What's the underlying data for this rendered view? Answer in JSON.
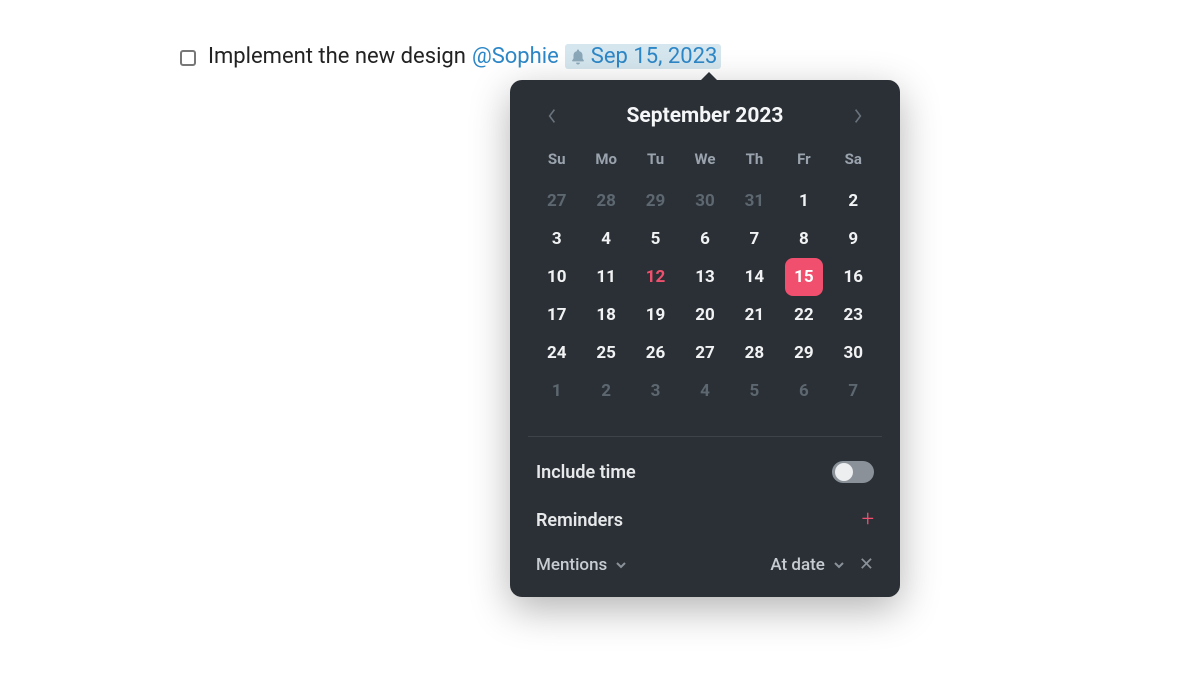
{
  "task": {
    "text": "Implement the new design",
    "mention": "@Sophie",
    "date_label": "Sep 15, 2023"
  },
  "calendar": {
    "month_title": "September 2023",
    "dows": [
      "Su",
      "Mo",
      "Tu",
      "We",
      "Th",
      "Fr",
      "Sa"
    ],
    "days": [
      {
        "n": "27",
        "out": true
      },
      {
        "n": "28",
        "out": true
      },
      {
        "n": "29",
        "out": true
      },
      {
        "n": "30",
        "out": true
      },
      {
        "n": "31",
        "out": true
      },
      {
        "n": "1"
      },
      {
        "n": "2"
      },
      {
        "n": "3"
      },
      {
        "n": "4"
      },
      {
        "n": "5"
      },
      {
        "n": "6"
      },
      {
        "n": "7"
      },
      {
        "n": "8"
      },
      {
        "n": "9"
      },
      {
        "n": "10"
      },
      {
        "n": "11"
      },
      {
        "n": "12",
        "today": true
      },
      {
        "n": "13"
      },
      {
        "n": "14"
      },
      {
        "n": "15",
        "selected": true
      },
      {
        "n": "16"
      },
      {
        "n": "17"
      },
      {
        "n": "18"
      },
      {
        "n": "19"
      },
      {
        "n": "20"
      },
      {
        "n": "21"
      },
      {
        "n": "22"
      },
      {
        "n": "23"
      },
      {
        "n": "24"
      },
      {
        "n": "25"
      },
      {
        "n": "26"
      },
      {
        "n": "27"
      },
      {
        "n": "28"
      },
      {
        "n": "29"
      },
      {
        "n": "30"
      },
      {
        "n": "1",
        "out": true
      },
      {
        "n": "2",
        "out": true
      },
      {
        "n": "3",
        "out": true
      },
      {
        "n": "4",
        "out": true
      },
      {
        "n": "5",
        "out": true
      },
      {
        "n": "6",
        "out": true
      },
      {
        "n": "7",
        "out": true
      }
    ]
  },
  "options": {
    "include_time_label": "Include time",
    "reminders_label": "Reminders",
    "reminder_type": "Mentions",
    "reminder_when": "At date"
  }
}
